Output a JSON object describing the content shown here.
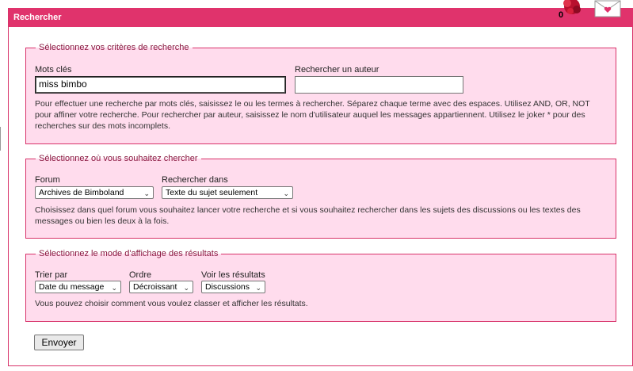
{
  "header": {
    "title": "Rechercher"
  },
  "notifications": {
    "count": "0"
  },
  "criteria": {
    "legend": "Sélectionnez vos critères de recherche",
    "keywords_label": "Mots clés",
    "keywords_value": "miss bimbo",
    "author_label": "Rechercher un auteur",
    "author_value": "",
    "help": "Pour effectuer une recherche par mots clés, saisissez le ou les termes à rechercher. Séparez chaque terme avec des espaces. Utilisez AND, OR, NOT pour affiner votre recherche. Pour rechercher par auteur, saisissez le nom d'utilisateur auquel les messages appartiennent. Utilisez le joker * pour des recherches sur des mots incomplets."
  },
  "where": {
    "legend": "Sélectionnez où vous souhaitez chercher",
    "forum_label": "Forum",
    "forum_value": "Archives de Bimboland",
    "searchin_label": "Rechercher dans",
    "searchin_value": "Texte du sujet seulement",
    "help": "Choisissez dans quel forum vous souhaitez lancer votre recherche et si vous souhaitez rechercher dans les sujets des discussions ou les textes des messages ou bien les deux à la fois."
  },
  "display": {
    "legend": "Sélectionnez le mode d'affichage des résultats",
    "sort_label": "Trier par",
    "sort_value": "Date du message",
    "order_label": "Ordre",
    "order_value": "Décroissant",
    "show_label": "Voir les résultats",
    "show_value": "Discussions",
    "help": "Vous pouvez choisir comment vous voulez classer et afficher les résultats."
  },
  "submit_label": "Envoyer",
  "colors": {
    "header": "#e0336c",
    "fieldset_bg": "#ffdced",
    "border": "#d8336a",
    "legend": "#8a1840"
  }
}
